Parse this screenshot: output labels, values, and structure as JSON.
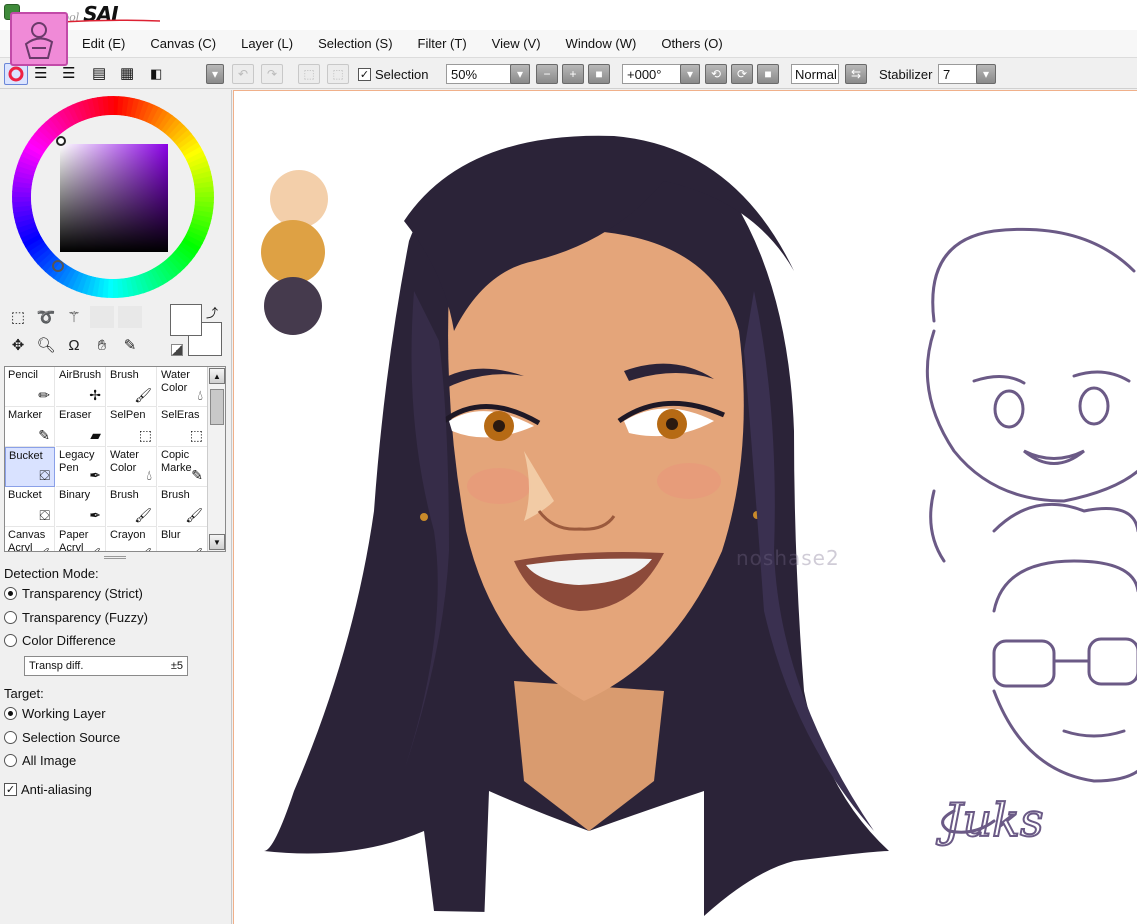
{
  "app": {
    "brand_sub": "Paint Tool",
    "brand_main": "SAI"
  },
  "menu": {
    "items": [
      "Edit (E)",
      "Canvas (C)",
      "Layer (L)",
      "Selection (S)",
      "Filter (T)",
      "View (V)",
      "Window (W)",
      "Others (O)"
    ]
  },
  "toolbar": {
    "selection_label": "Selection",
    "selection_checked": true,
    "zoom": "50%",
    "rotation": "+000°",
    "blend_mode": "Normal",
    "stabilizer_label": "Stabilizer",
    "stabilizer_value": "7"
  },
  "tools": {
    "brushes": [
      {
        "label": "Pencil",
        "icon": "pencil-icon"
      },
      {
        "label": "AirBrush",
        "icon": "airbrush-icon"
      },
      {
        "label": "Brush",
        "icon": "brush-icon"
      },
      {
        "label": "Water Color",
        "icon": "watercolor-icon"
      },
      {
        "label": "Marker",
        "icon": "marker-icon"
      },
      {
        "label": "Eraser",
        "icon": "eraser-icon"
      },
      {
        "label": "SelPen",
        "icon": "selpen-icon"
      },
      {
        "label": "SelEras",
        "icon": "seleraser-icon"
      },
      {
        "label": "Bucket",
        "icon": "bucket-icon",
        "active": true
      },
      {
        "label": "Legacy Pen",
        "icon": "pen-icon"
      },
      {
        "label": "Water Color",
        "icon": "watercolor-icon"
      },
      {
        "label": "Copic Marke",
        "icon": "marker-icon"
      },
      {
        "label": "Bucket",
        "icon": "bucket-icon"
      },
      {
        "label": "Binary",
        "icon": "pen-icon"
      },
      {
        "label": "Brush",
        "icon": "brush-icon"
      },
      {
        "label": "Brush",
        "icon": "brush-icon"
      },
      {
        "label": "Canvas Acryl",
        "icon": "brush-icon"
      },
      {
        "label": "Paper Acryl",
        "icon": "brush-icon"
      },
      {
        "label": "Crayon",
        "icon": "brush-icon"
      },
      {
        "label": "Blur",
        "icon": "brush-icon"
      }
    ]
  },
  "options": {
    "detection_label": "Detection Mode:",
    "detection_modes": [
      {
        "label": "Transparency (Strict)",
        "selected": true
      },
      {
        "label": "Transparency (Fuzzy)",
        "selected": false
      },
      {
        "label": "Color Difference",
        "selected": false
      }
    ],
    "diff_label": "Transp diff.",
    "diff_value": "±5",
    "target_label": "Target:",
    "targets": [
      {
        "label": "Working Layer",
        "selected": true
      },
      {
        "label": "Selection Source",
        "selected": false
      },
      {
        "label": "All Image",
        "selected": false
      }
    ],
    "antialias_label": "Anti-aliasing",
    "antialias_checked": true
  },
  "colors": {
    "palette": [
      "#f3cfaa",
      "#dea144",
      "#453a4d"
    ],
    "hair": "#2b2338",
    "skin": "#e4a57a",
    "sketch": "#6b5a86"
  },
  "canvas": {
    "watermark": "noshase2",
    "signature": "Juks"
  }
}
